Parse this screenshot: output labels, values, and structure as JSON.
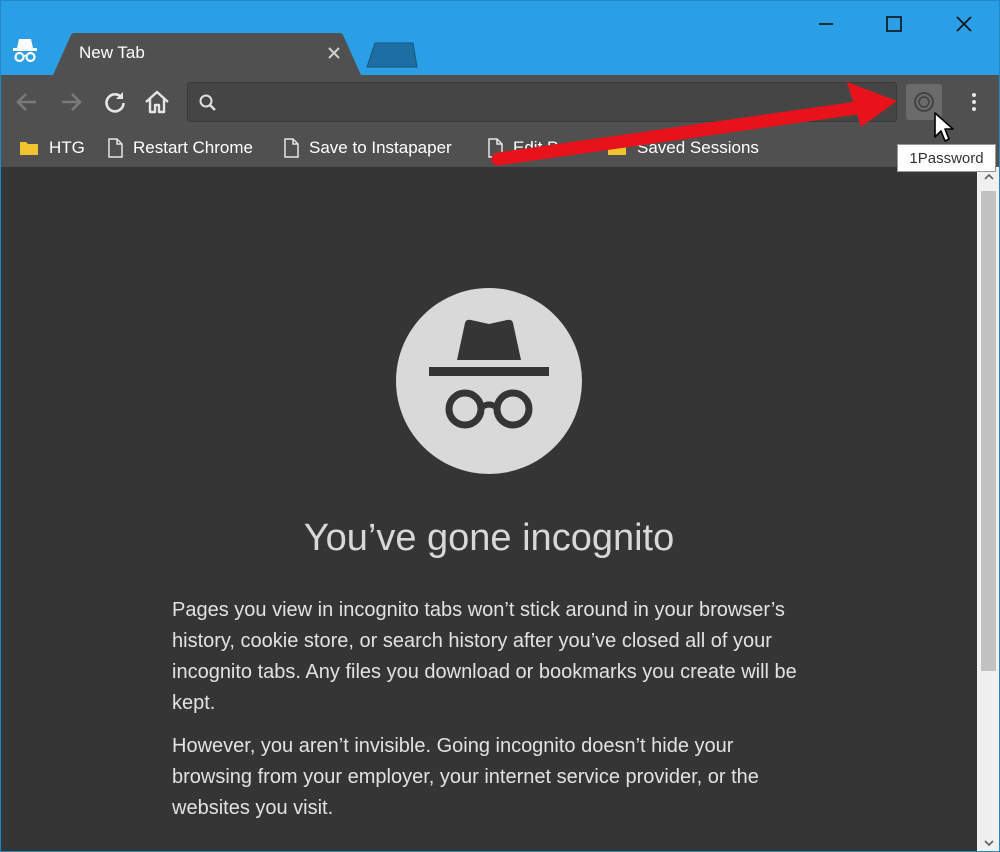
{
  "tab": {
    "title": "New Tab"
  },
  "omnibox": {
    "value": "",
    "placeholder": ""
  },
  "bookmarks": [
    {
      "label": "HTG",
      "icon": "folder-icon"
    },
    {
      "label": "Restart Chrome",
      "icon": "page-icon"
    },
    {
      "label": "Save to Instapaper",
      "icon": "page-icon"
    },
    {
      "label": "Edit Post",
      "icon": "page-icon"
    },
    {
      "label": "Saved Sessions",
      "icon": "folder-icon"
    }
  ],
  "tooltip": "1Password",
  "content": {
    "heading": "You’ve gone incognito",
    "paragraph1": "Pages you view in incognito tabs won’t stick around in your browser’s history, cookie store, or search history after you’ve closed all of your incognito tabs. Any files you download or bookmarks you create will be kept.",
    "paragraph2": "However, you aren’t invisible. Going incognito doesn’t hide your browsing from your employer, your internet service provider, or the websites you visit."
  },
  "colors": {
    "titlebar": "#2a9fe6",
    "toolbar": "#505050",
    "content_bg": "#353535",
    "annotation_arrow": "#e8121b"
  }
}
